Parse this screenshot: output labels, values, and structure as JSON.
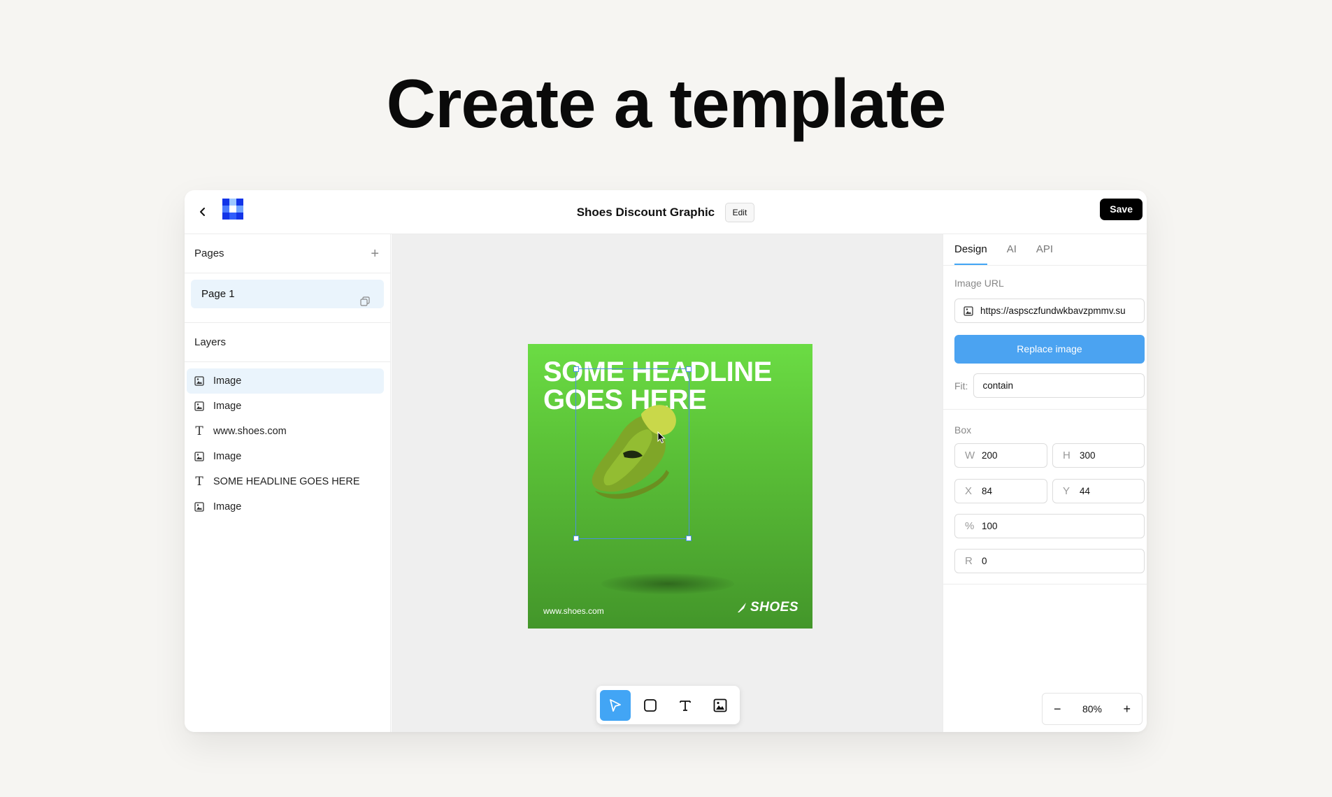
{
  "hero": {
    "title": "Create a template"
  },
  "header": {
    "doc_title": "Shoes Discount Graphic",
    "edit_label": "Edit",
    "save_label": "Save"
  },
  "left": {
    "pages_title": "Pages",
    "pages": [
      {
        "label": "Page 1"
      }
    ],
    "layers_title": "Layers",
    "layers": [
      {
        "label": "Image",
        "type": "image"
      },
      {
        "label": "Image",
        "type": "image"
      },
      {
        "label": "www.shoes.com",
        "type": "text"
      },
      {
        "label": "Image",
        "type": "image"
      },
      {
        "label": "SOME HEADLINE GOES HERE",
        "type": "text"
      },
      {
        "label": "Image",
        "type": "image"
      }
    ]
  },
  "artboard": {
    "headline_line1": "SOME HEADLINE",
    "headline_line2": "GOES HERE",
    "site": "www.shoes.com",
    "brand": "SHOES",
    "bg_color": "#5cc338"
  },
  "toolbar": {
    "tools": [
      "select-tool",
      "rectangle-tool",
      "text-tool",
      "image-tool"
    ],
    "active": "select-tool"
  },
  "right": {
    "tabs": [
      "Design",
      "AI",
      "API"
    ],
    "active_tab": "Design",
    "image_url_label": "Image URL",
    "image_url": "https://aspsczfundwkbavzpmmv.su",
    "replace_label": "Replace image",
    "fit_label": "Fit:",
    "fit_value": "contain",
    "box_label": "Box",
    "w_key": "W",
    "w": "200",
    "h_key": "H",
    "h": "300",
    "x_key": "X",
    "x": "84",
    "y_key": "Y",
    "y": "44",
    "pct_key": "%",
    "pct": "100",
    "r_key": "R",
    "r": "0",
    "zoom": "80%",
    "accent": "#42a5f5"
  }
}
